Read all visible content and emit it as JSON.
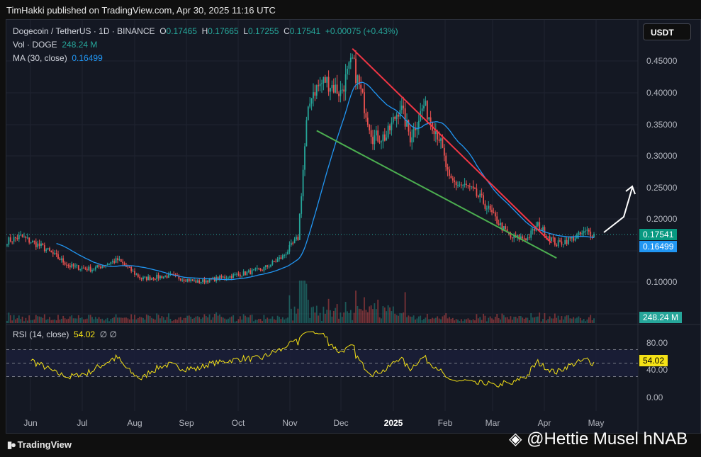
{
  "published": "TimHakki published on TradingView.com, Apr 30, 2025 11:16 UTC",
  "legend": {
    "symbol": "Dogecoin / TetherUS · 1D · BINANCE",
    "o_label": "O",
    "o": "0.17465",
    "h_label": "H",
    "h": "0.17665",
    "l_label": "L",
    "l": "0.17255",
    "c_label": "C",
    "c": "0.17541",
    "change": "+0.00075 (+0.43%)",
    "vol_label": "Vol · DOGE",
    "vol": "248.24 M",
    "ma_label": "MA (30, close)",
    "ma": "0.16499",
    "rsi_label": "RSI (14, close)",
    "rsi": "54.02",
    "rsi_extra": "∅ ∅"
  },
  "currency_button": "USDT",
  "price_axis": [
    "0.45000",
    "0.40000",
    "0.35000",
    "0.30000",
    "0.25000",
    "0.20000",
    "0.10000"
  ],
  "rsi_axis": [
    "80.00",
    "40.00",
    "0.00"
  ],
  "tags": {
    "close": "0.17541",
    "ma": "0.16499",
    "vol": "248.24 M",
    "rsi": "54.02"
  },
  "x_axis": [
    "Jun",
    "Jul",
    "Aug",
    "Sep",
    "Oct",
    "Nov",
    "Dec",
    "2025",
    "Feb",
    "Mar",
    "Apr",
    "May"
  ],
  "footer": {
    "brand": "TradingView",
    "watermark": "@Hettie Musel hNAB"
  },
  "colors": {
    "up": "#26a69a",
    "down": "#ef5350",
    "ma": "#2196f3",
    "rsi": "#f5e216",
    "resistance": "#f23645",
    "support": "#4caf50"
  },
  "chart_data": {
    "type": "candlestick",
    "start": "2024-05-18",
    "price_range": [
      0.05,
      0.48
    ],
    "path": [
      [
        "2024-05-18",
        0.165
      ],
      [
        "2024-05-26",
        0.172
      ],
      [
        "2024-06-08",
        0.155
      ],
      [
        "2024-06-24",
        0.125
      ],
      [
        "2024-07-07",
        0.12
      ],
      [
        "2024-07-22",
        0.135
      ],
      [
        "2024-08-05",
        0.105
      ],
      [
        "2024-08-22",
        0.11
      ],
      [
        "2024-09-07",
        0.1
      ],
      [
        "2024-09-28",
        0.11
      ],
      [
        "2024-10-15",
        0.12
      ],
      [
        "2024-10-27",
        0.14
      ],
      [
        "2024-11-05",
        0.17
      ],
      [
        "2024-11-10",
        0.35
      ],
      [
        "2024-11-13",
        0.4
      ],
      [
        "2024-11-21",
        0.42
      ],
      [
        "2024-11-30",
        0.4
      ],
      [
        "2024-12-07",
        0.45
      ],
      [
        "2024-12-12",
        0.4
      ],
      [
        "2024-12-19",
        0.33
      ],
      [
        "2024-12-27",
        0.33
      ],
      [
        "2025-01-04",
        0.38
      ],
      [
        "2025-01-10",
        0.33
      ],
      [
        "2025-01-18",
        0.38
      ],
      [
        "2025-01-27",
        0.33
      ],
      [
        "2025-02-02",
        0.26
      ],
      [
        "2025-02-13",
        0.25
      ],
      [
        "2025-02-21",
        0.23
      ],
      [
        "2025-03-01",
        0.2
      ],
      [
        "2025-03-10",
        0.17
      ],
      [
        "2025-03-20",
        0.17
      ],
      [
        "2025-03-26",
        0.19
      ],
      [
        "2025-04-06",
        0.16
      ],
      [
        "2025-04-16",
        0.17
      ],
      [
        "2025-04-24",
        0.18
      ],
      [
        "2025-04-28",
        0.175
      ]
    ],
    "resistance_line": [
      [
        "2024-12-07",
        0.47
      ],
      [
        "2025-04-03",
        0.162
      ]
    ],
    "support_line": [
      [
        "2024-11-16",
        0.34
      ],
      [
        "2025-04-06",
        0.138
      ]
    ],
    "rsi_levels": [
      70,
      50,
      30
    ]
  }
}
